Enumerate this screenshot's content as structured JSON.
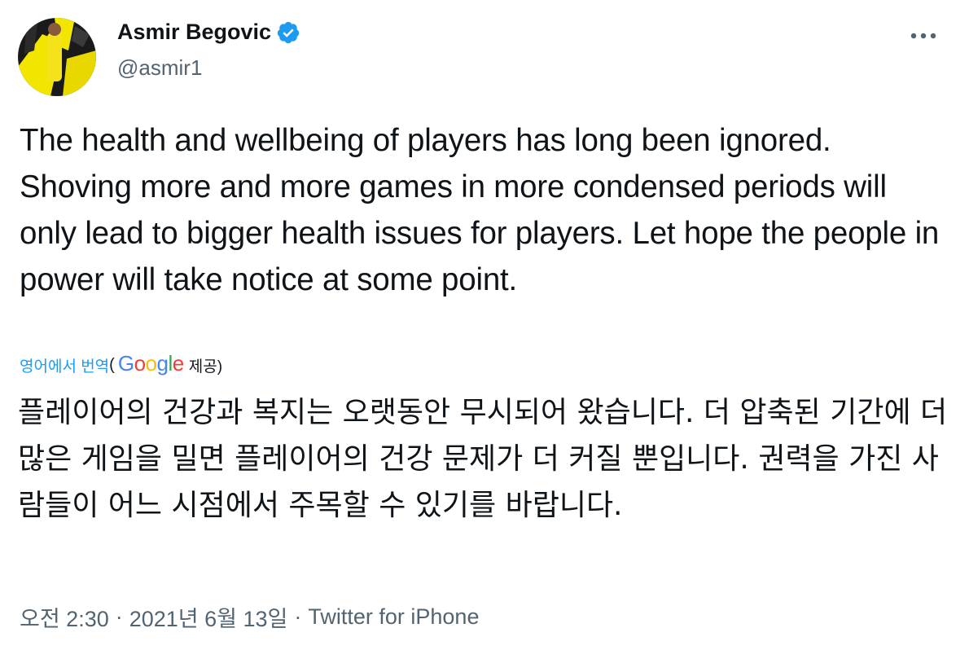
{
  "author": {
    "display_name": "Asmir Begovic",
    "handle": "@asmir1",
    "verified": true
  },
  "more_icon": "more-horizontal-icon",
  "tweet": {
    "text": "The health and wellbeing of players has long been ignored. Shoving more and more games in more condensed periods will only lead to bigger health issues for players. Let hope the people in power will take notice at some point."
  },
  "translation": {
    "link_label": "영어에서 번역",
    "open_paren": "(",
    "provider": "Google",
    "provided_label": "제공)",
    "text": "플레이어의 건강과 복지는 오랫동안 무시되어 왔습니다. 더 압축된 기간에 더 많은 게임을 밀면 플레이어의 건강 문제가 더 커질 뿐입니다. 권력을 가진 사람들이 어느 시점에서 주목할 수 있기를 바랍니다."
  },
  "meta": {
    "time": "오전 2:30",
    "separator": "·",
    "date": "2021년 6월 13일",
    "source": "Twitter for iPhone"
  },
  "colors": {
    "accent": "#1d9bf0",
    "secondary_text": "#536471",
    "primary_text": "#0f1419",
    "google_blue": "#4285F4",
    "google_red": "#EA4335",
    "google_yellow": "#FBBC05",
    "google_green": "#34A853"
  }
}
